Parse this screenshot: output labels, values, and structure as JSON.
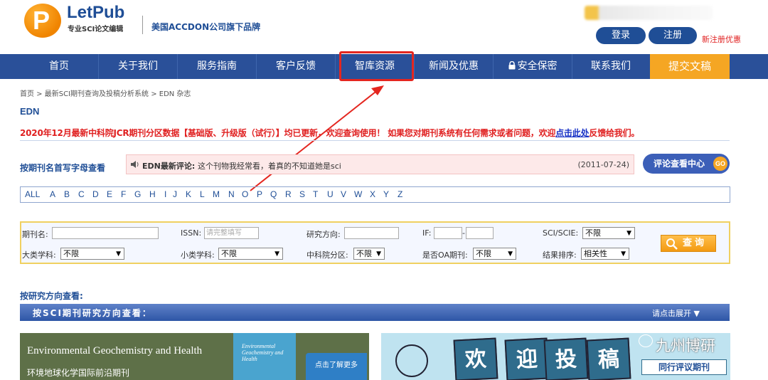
{
  "header": {
    "logo_letter": "P",
    "logo_name": "LetPub",
    "logo_tagline": "专业SCI论文编辑",
    "brand_text": "美国ACCDON公司旗下品牌",
    "login_label": "登录",
    "register_label": "注册",
    "register_promo": "新注册优惠"
  },
  "nav": {
    "items": [
      "首页",
      "关于我们",
      "服务指南",
      "客户反馈",
      "智库资源",
      "新闻及优惠",
      "安全保密",
      "联系我们"
    ],
    "submit_label": "提交文稿",
    "highlighted": "智库资源"
  },
  "breadcrumb": "首页 > 最新SCI期刊查询及投稿分析系统 > EDN 杂志",
  "page_title": "EDN",
  "notice": {
    "text_before": "2020年12月最新中科院JCR期刊分区数据【基础版、升级版（试行）】均已更新，欢迎查询使用！ 如果您对期刊系统有任何需求或者问题，欢迎",
    "link": "点击此处",
    "text_after": "反馈给我们。"
  },
  "browse": {
    "title": "按期刊名首写字母查看",
    "letters": [
      "ALL",
      "A",
      "B",
      "C",
      "D",
      "E",
      "F",
      "G",
      "H",
      "I",
      "J",
      "K",
      "L",
      "M",
      "N",
      "O",
      "P",
      "Q",
      "R",
      "S",
      "T",
      "U",
      "V",
      "W",
      "X",
      "Y",
      "Z"
    ]
  },
  "comment": {
    "label": "EDN最新评论:",
    "text": "这个刊物我经常看，着真的不知道她是sci",
    "date": "(2011-07-24)"
  },
  "review_center": {
    "label": "评论查看中心",
    "badge": "GO"
  },
  "search": {
    "journal_name_label": "期刊名:",
    "issn_label": "ISSN:",
    "issn_placeholder": "请完整填写",
    "research_label": "研究方向:",
    "if_label": "IF:",
    "if_dash": "-",
    "sci_label": "SCI/SCIE:",
    "sci_value": "不限",
    "major_label": "大类学科:",
    "major_value": "不限",
    "minor_label": "小类学科:",
    "minor_value": "不限",
    "cas_label": "中科院分区:",
    "cas_value": "不限",
    "oa_label": "是否OA期刊:",
    "oa_value": "不限",
    "sort_label": "结果排序:",
    "sort_value": "相关性",
    "button_label": "查询"
  },
  "research": {
    "title": "按研究方向查看:",
    "bar_label": "按SCI期刊研究方向查看：",
    "expand_label": "请点击展开 ▼"
  },
  "banner_left": {
    "title": "Environmental Geochemistry and Health",
    "subtitle": "环境地球化学国际前沿期刊",
    "cover_text": "Environmental Geochemistry and Health",
    "cta": "点击了解更多"
  },
  "banner_right": {
    "boards": [
      "欢",
      "迎",
      "投",
      "稿"
    ],
    "tag": "同行评议期刊"
  },
  "watermark": "九州博研"
}
